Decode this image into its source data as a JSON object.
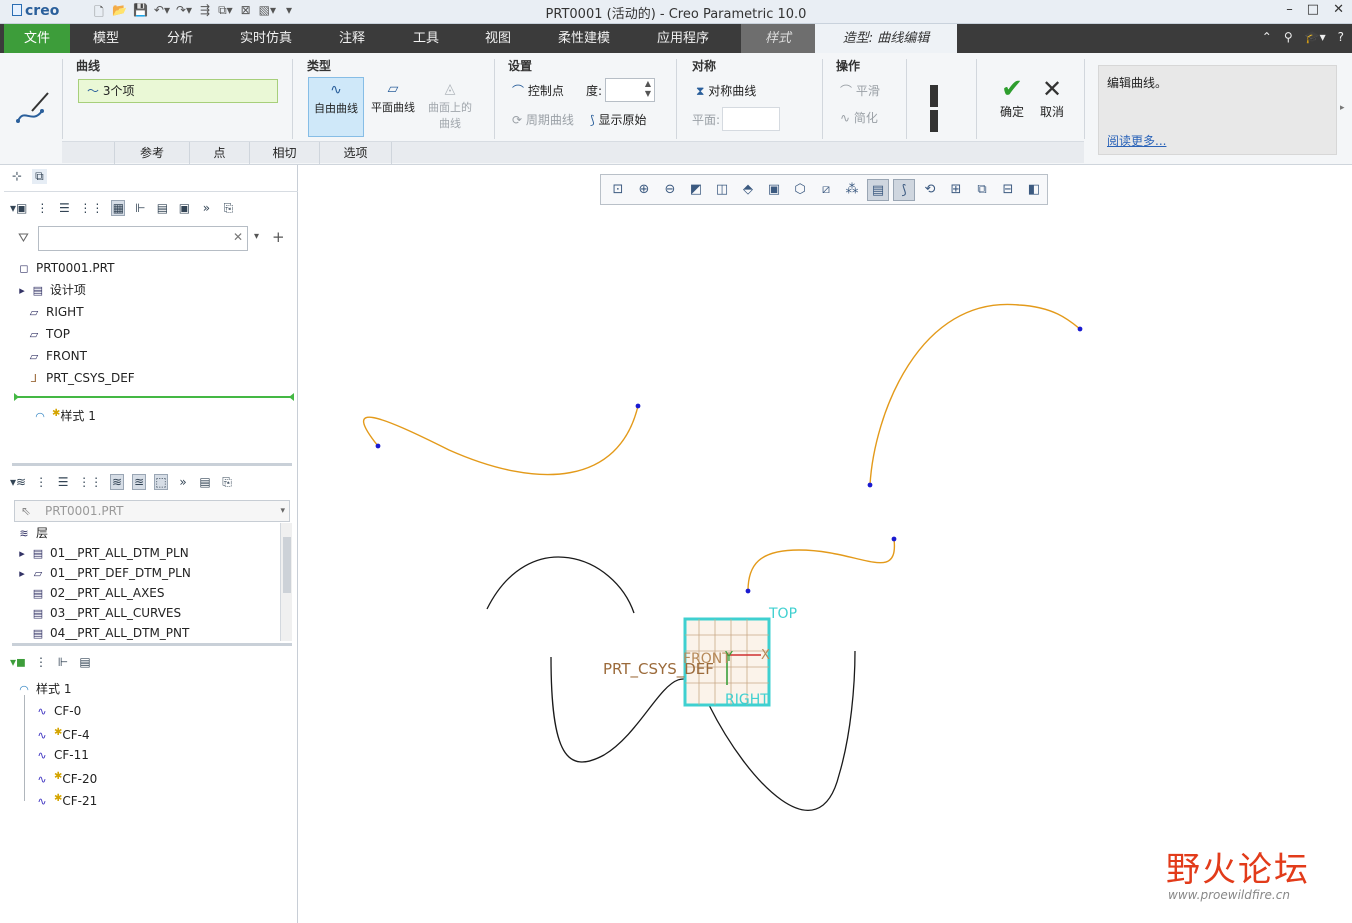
{
  "app": {
    "logo": "creo",
    "window_title": "PRT0001 (活动的) - Creo Parametric 10.0",
    "window_controls": [
      "–",
      "□",
      "✕"
    ]
  },
  "menu": {
    "file": "文件",
    "items": [
      "模型",
      "分析",
      "实时仿真",
      "注释",
      "工具",
      "视图",
      "柔性建模",
      "应用程序"
    ],
    "style_tab": "样式",
    "active_tab": "造型: 曲线编辑"
  },
  "ribbon": {
    "curve_group": {
      "title": "曲线",
      "value": "3个项"
    },
    "type_group": {
      "title": "类型",
      "free": "自由曲线",
      "plane": "平面曲线",
      "surface_1": "曲面上的",
      "surface_2": "曲线"
    },
    "settings_group": {
      "title": "设置",
      "control_points": "控制点",
      "degree": "度:",
      "degree_value": "",
      "periodic": "周期曲线",
      "show_original": "显示原始"
    },
    "symmetry_group": {
      "title": "对称",
      "symmetric_curve": "对称曲线",
      "plane": "平面:"
    },
    "operations_group": {
      "title": "操作",
      "smooth": "平滑",
      "simplify": "简化"
    },
    "ok": "确定",
    "cancel": "取消",
    "help_text": "编辑曲线。",
    "help_link": "阅读更多...",
    "sub_tabs": [
      "参考",
      "点",
      "相切",
      "选项"
    ]
  },
  "model_tree": {
    "root": "PRT0001.PRT",
    "items": [
      {
        "label": "设计项",
        "icon": "design-items-icon"
      },
      {
        "label": "RIGHT",
        "icon": "datum-plane-icon"
      },
      {
        "label": "TOP",
        "icon": "datum-plane-icon"
      },
      {
        "label": "FRONT",
        "icon": "datum-plane-icon"
      },
      {
        "label": "PRT_CSYS_DEF",
        "icon": "csys-icon"
      }
    ],
    "style_feature": "样式 1"
  },
  "layer_tree": {
    "selector": "PRT0001.PRT",
    "header": "层",
    "layers": [
      "01__PRT_ALL_DTM_PLN",
      "01__PRT_DEF_DTM_PLN",
      "02__PRT_ALL_AXES",
      "03__PRT_ALL_CURVES",
      "04__PRT_ALL_DTM_PNT"
    ]
  },
  "style_tree": {
    "root": "样式 1",
    "curves": [
      {
        "label": "CF-0",
        "modified": false
      },
      {
        "label": "CF-4",
        "modified": true
      },
      {
        "label": "CF-11",
        "modified": false
      },
      {
        "label": "CF-20",
        "modified": true
      },
      {
        "label": "CF-21",
        "modified": true
      }
    ]
  },
  "graphics": {
    "labels": {
      "top": "TOP",
      "front": "FRONT",
      "right": "RIGHT",
      "csys": "PRT_CSYS_DEF",
      "x": "X",
      "y": "Y"
    },
    "colors": {
      "selected_curve": "#e39a1a",
      "curve": "#1a1a1a",
      "point": "#1a1ad0",
      "plane": "#3fd0d0",
      "csys": "#9b6a3a"
    }
  },
  "watermark": {
    "text": "野火论坛",
    "url": "www.proewildfire.cn"
  },
  "colors": {
    "menu_bg": "#3b3b3b",
    "file_tab": "#3d9d3a",
    "active_tab_bg": "#eef2f6"
  }
}
